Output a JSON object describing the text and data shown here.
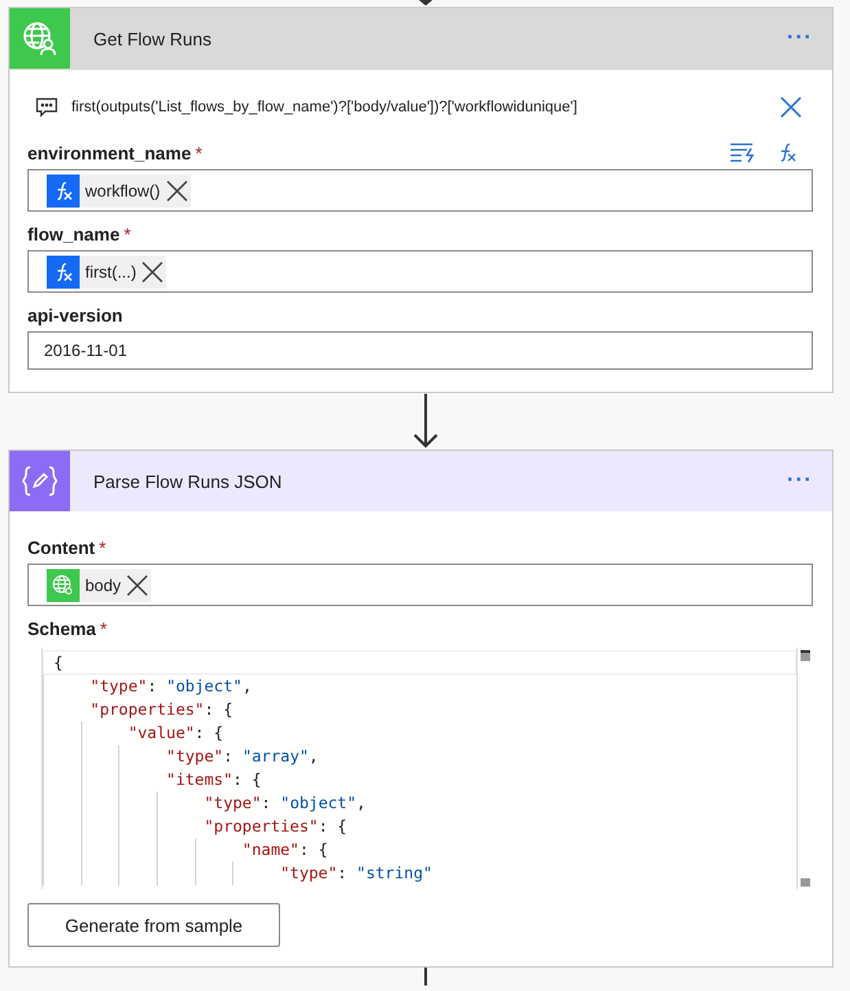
{
  "steps": [
    {
      "kind": "http",
      "title": "Get Flow Runs",
      "menu": "···",
      "tooltip": {
        "text": "first(outputs('List_flows_by_flow_name')?['body/value'])?['workflowidunique']"
      },
      "fields": [
        {
          "kind": "tokens",
          "label": "environment_name",
          "required": "*",
          "actions": [
            {
              "kind": "dynamic-content"
            },
            {
              "kind": "expression"
            }
          ],
          "tokens": [
            {
              "kind": "expression",
              "text": "workflow()"
            }
          ]
        },
        {
          "kind": "tokens",
          "label": "flow_name",
          "required": "*",
          "tokens": [
            {
              "kind": "expression",
              "text": "first(...)"
            }
          ]
        },
        {
          "kind": "text",
          "label": "api-version",
          "value": "2016-11-01"
        }
      ]
    },
    {
      "kind": "parse",
      "title": "Parse Flow Runs JSON",
      "menu": "···",
      "fields": [
        {
          "kind": "tokens",
          "label": "Content",
          "required": "*",
          "tokens": [
            {
              "kind": "http",
              "text": "body"
            }
          ]
        },
        {
          "kind": "code",
          "label": "Schema",
          "required": "*",
          "lines": [
            "{",
            "    \"type\": \"object\",",
            "    \"properties\": {",
            "        \"value\": {",
            "            \"type\": \"array\",",
            "            \"items\": {",
            "                \"type\": \"object\",",
            "                \"properties\": {",
            "                    \"name\": {",
            "                        \"type\": \"string\""
          ]
        }
      ],
      "button": "Generate from sample"
    }
  ]
}
